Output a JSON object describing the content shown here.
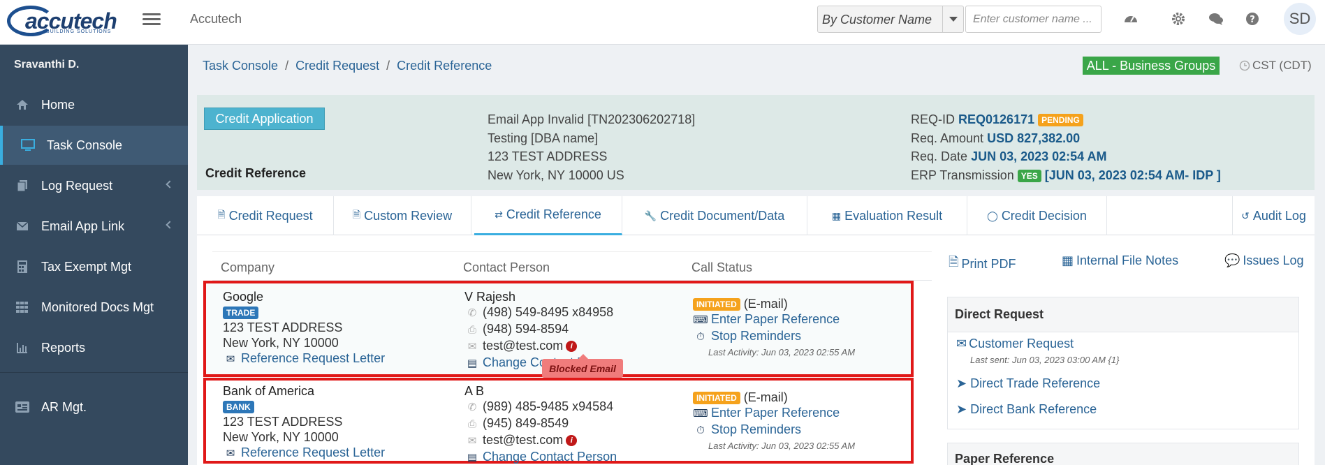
{
  "topbar": {
    "logo_text": "accutech",
    "logo_sub": "BUILDING SOLUTIONS",
    "app_name": "Accutech",
    "search_type": "By Customer Name",
    "search_placeholder": "Enter customer name ...",
    "avatar_initials": "SD",
    "icons": [
      "dashboard-icon",
      "gear-icon",
      "chat-icon",
      "help-icon"
    ]
  },
  "sidebar": {
    "user": "Sravanthi D.",
    "items": [
      {
        "label": "Home",
        "icon": "home-icon"
      },
      {
        "label": "Task Console",
        "icon": "monitor-icon"
      },
      {
        "label": "Log Request",
        "icon": "document-icon"
      },
      {
        "label": "Email App Link",
        "icon": "envelope-icon"
      },
      {
        "label": "Tax Exempt Mgt",
        "icon": "calculator-icon"
      },
      {
        "label": "Monitored Docs Mgt",
        "icon": "grid-icon"
      },
      {
        "label": "Reports",
        "icon": "bar-chart-icon"
      },
      {
        "label": "AR Mgt.",
        "icon": "id-card-icon"
      }
    ]
  },
  "breadcrumb": [
    "Task Console",
    "Credit Request",
    "Credit Reference"
  ],
  "business_group": "ALL - Business Groups",
  "timezone": "CST (CDT)",
  "header": {
    "button": "Credit Application",
    "title": "Credit Reference",
    "mid": [
      "Email App Invalid [TN202306202718]",
      "Testing [DBA name]",
      "123 TEST ADDRESS",
      "New York, NY 10000 US"
    ],
    "req_id_label": "REQ-ID",
    "req_id": "REQ0126171",
    "status": "PENDING",
    "amount_label": "Req. Amount",
    "amount": "USD 827,382.00",
    "date_label": "Req. Date",
    "date": "JUN 03, 2023 02:54 AM",
    "erp_label": "ERP Transmission",
    "erp_flag": "YES",
    "erp_value": "[JUN 03, 2023 02:54 AM- IDP ]"
  },
  "tabs": [
    "Credit Request",
    "Custom Review",
    "Credit Reference",
    "Credit Document/Data",
    "Evaluation Result",
    "Credit Decision",
    "Audit Log"
  ],
  "table": {
    "headers": [
      "Company",
      "Contact Person",
      "Call Status"
    ],
    "rows": [
      {
        "company": "Google",
        "type": "TRADE",
        "address": "123 TEST ADDRESS",
        "city": "New York, NY 10000",
        "letter": "Reference Request Letter",
        "contact": "V Rajesh",
        "phone": "(498) 549-8495 x84958",
        "fax": "(948) 594-8594",
        "email": "test@test.com",
        "change": "Change Contact Person",
        "status": "INITIATED",
        "status_mode": "(E-mail)",
        "paper": "Enter Paper Reference",
        "stop": "Stop Reminders",
        "last": "Last Activity: Jun 03, 2023 02:55 AM"
      },
      {
        "company": "Bank of America",
        "type": "BANK",
        "address": "123 TEST ADDRESS",
        "city": "New York, NY 10000",
        "letter": "Reference Request Letter",
        "contact": "A B",
        "phone": "(989) 485-9485 x94584",
        "fax": "(945) 849-8549",
        "email": "test@test.com",
        "change": "Change Contact Person",
        "status": "INITIATED",
        "status_mode": "(E-mail)",
        "paper": "Enter Paper Reference",
        "stop": "Stop Reminders",
        "last": "Last Activity: Jun 03, 2023 02:55 AM"
      }
    ],
    "tooltip": "Blocked Email"
  },
  "right": {
    "print": "Print PDF",
    "notes": "Internal File Notes",
    "issues": "Issues Log",
    "direct_head": "Direct Request",
    "customer_request": "Customer Request",
    "last_sent": "Last sent: Jun 03, 2023 03:00 AM {1}",
    "trade_ref": "Direct Trade Reference",
    "bank_ref": "Direct Bank Reference",
    "paper_head": "Paper Reference"
  },
  "colors": {
    "sidebar": "#34495e",
    "accent": "#3aaee0",
    "link": "#2a6496",
    "highlight": "#e01818"
  }
}
